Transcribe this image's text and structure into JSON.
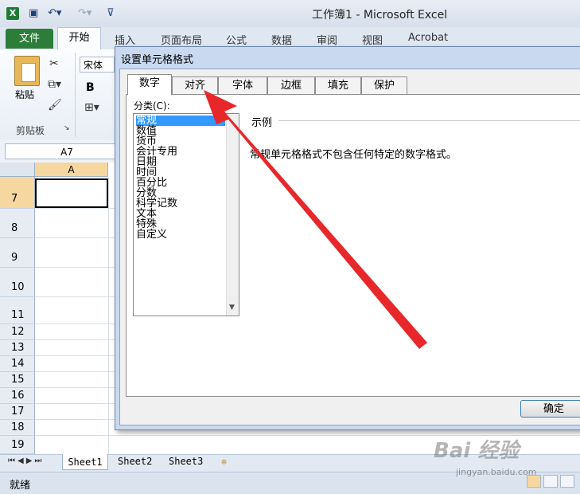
{
  "window": {
    "title": "工作簿1 - Microsoft Excel"
  },
  "ribbon": {
    "tabs": {
      "file": "文件",
      "home": "开始",
      "insert": "插入",
      "page_layout": "页面布局",
      "formulas": "公式",
      "data": "数据",
      "review": "审阅",
      "view": "视图",
      "acrobat": "Acrobat"
    },
    "clipboard": {
      "paste_label": "粘贴",
      "group_label": "剪贴板"
    },
    "font": {
      "name": "宋体",
      "bold": "B"
    }
  },
  "formula_bar": {
    "name_box": "A7"
  },
  "grid": {
    "column_a": "A",
    "rows": [
      "7",
      "8",
      "9",
      "10",
      "11",
      "12",
      "13",
      "14",
      "15",
      "16",
      "17",
      "18",
      "19"
    ]
  },
  "sheets": [
    "Sheet1",
    "Sheet2",
    "Sheet3"
  ],
  "status": {
    "ready": "就绪"
  },
  "dialog": {
    "title": "设置单元格格式",
    "tabs": [
      "数字",
      "对齐",
      "字体",
      "边框",
      "填充",
      "保护"
    ],
    "category_label": "分类(C):",
    "categories": [
      "常规",
      "数值",
      "货币",
      "会计专用",
      "日期",
      "时间",
      "百分比",
      "分数",
      "科学记数",
      "文本",
      "特殊",
      "自定义"
    ],
    "sample_label": "示例",
    "description": "常规单元格格式不包含任何特定的数字格式。",
    "ok_label": "确定"
  },
  "watermark": {
    "text": "Bai 经验",
    "url": "jingyan.baidu.com"
  },
  "colors": {
    "file_tab": "#2d7d3a",
    "selection": "#3399ff",
    "arrow": "#e8272b",
    "dialog_frame": "#c9daf0"
  }
}
